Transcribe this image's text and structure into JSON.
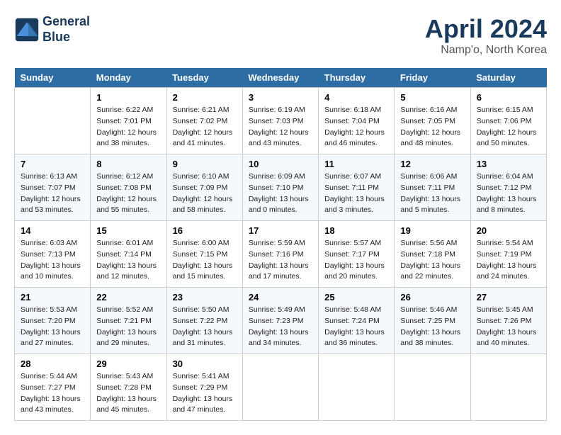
{
  "header": {
    "logo_line1": "General",
    "logo_line2": "Blue",
    "title": "April 2024",
    "subtitle": "Namp'o, North Korea"
  },
  "weekdays": [
    "Sunday",
    "Monday",
    "Tuesday",
    "Wednesday",
    "Thursday",
    "Friday",
    "Saturday"
  ],
  "weeks": [
    [
      null,
      {
        "day": "1",
        "sunrise": "6:22 AM",
        "sunset": "7:01 PM",
        "daylight": "12 hours and 38 minutes."
      },
      {
        "day": "2",
        "sunrise": "6:21 AM",
        "sunset": "7:02 PM",
        "daylight": "12 hours and 41 minutes."
      },
      {
        "day": "3",
        "sunrise": "6:19 AM",
        "sunset": "7:03 PM",
        "daylight": "12 hours and 43 minutes."
      },
      {
        "day": "4",
        "sunrise": "6:18 AM",
        "sunset": "7:04 PM",
        "daylight": "12 hours and 46 minutes."
      },
      {
        "day": "5",
        "sunrise": "6:16 AM",
        "sunset": "7:05 PM",
        "daylight": "12 hours and 48 minutes."
      },
      {
        "day": "6",
        "sunrise": "6:15 AM",
        "sunset": "7:06 PM",
        "daylight": "12 hours and 50 minutes."
      }
    ],
    [
      {
        "day": "7",
        "sunrise": "6:13 AM",
        "sunset": "7:07 PM",
        "daylight": "12 hours and 53 minutes."
      },
      {
        "day": "8",
        "sunrise": "6:12 AM",
        "sunset": "7:08 PM",
        "daylight": "12 hours and 55 minutes."
      },
      {
        "day": "9",
        "sunrise": "6:10 AM",
        "sunset": "7:09 PM",
        "daylight": "12 hours and 58 minutes."
      },
      {
        "day": "10",
        "sunrise": "6:09 AM",
        "sunset": "7:10 PM",
        "daylight": "13 hours and 0 minutes."
      },
      {
        "day": "11",
        "sunrise": "6:07 AM",
        "sunset": "7:11 PM",
        "daylight": "13 hours and 3 minutes."
      },
      {
        "day": "12",
        "sunrise": "6:06 AM",
        "sunset": "7:11 PM",
        "daylight": "13 hours and 5 minutes."
      },
      {
        "day": "13",
        "sunrise": "6:04 AM",
        "sunset": "7:12 PM",
        "daylight": "13 hours and 8 minutes."
      }
    ],
    [
      {
        "day": "14",
        "sunrise": "6:03 AM",
        "sunset": "7:13 PM",
        "daylight": "13 hours and 10 minutes."
      },
      {
        "day": "15",
        "sunrise": "6:01 AM",
        "sunset": "7:14 PM",
        "daylight": "13 hours and 12 minutes."
      },
      {
        "day": "16",
        "sunrise": "6:00 AM",
        "sunset": "7:15 PM",
        "daylight": "13 hours and 15 minutes."
      },
      {
        "day": "17",
        "sunrise": "5:59 AM",
        "sunset": "7:16 PM",
        "daylight": "13 hours and 17 minutes."
      },
      {
        "day": "18",
        "sunrise": "5:57 AM",
        "sunset": "7:17 PM",
        "daylight": "13 hours and 20 minutes."
      },
      {
        "day": "19",
        "sunrise": "5:56 AM",
        "sunset": "7:18 PM",
        "daylight": "13 hours and 22 minutes."
      },
      {
        "day": "20",
        "sunrise": "5:54 AM",
        "sunset": "7:19 PM",
        "daylight": "13 hours and 24 minutes."
      }
    ],
    [
      {
        "day": "21",
        "sunrise": "5:53 AM",
        "sunset": "7:20 PM",
        "daylight": "13 hours and 27 minutes."
      },
      {
        "day": "22",
        "sunrise": "5:52 AM",
        "sunset": "7:21 PM",
        "daylight": "13 hours and 29 minutes."
      },
      {
        "day": "23",
        "sunrise": "5:50 AM",
        "sunset": "7:22 PM",
        "daylight": "13 hours and 31 minutes."
      },
      {
        "day": "24",
        "sunrise": "5:49 AM",
        "sunset": "7:23 PM",
        "daylight": "13 hours and 34 minutes."
      },
      {
        "day": "25",
        "sunrise": "5:48 AM",
        "sunset": "7:24 PM",
        "daylight": "13 hours and 36 minutes."
      },
      {
        "day": "26",
        "sunrise": "5:46 AM",
        "sunset": "7:25 PM",
        "daylight": "13 hours and 38 minutes."
      },
      {
        "day": "27",
        "sunrise": "5:45 AM",
        "sunset": "7:26 PM",
        "daylight": "13 hours and 40 minutes."
      }
    ],
    [
      {
        "day": "28",
        "sunrise": "5:44 AM",
        "sunset": "7:27 PM",
        "daylight": "13 hours and 43 minutes."
      },
      {
        "day": "29",
        "sunrise": "5:43 AM",
        "sunset": "7:28 PM",
        "daylight": "13 hours and 45 minutes."
      },
      {
        "day": "30",
        "sunrise": "5:41 AM",
        "sunset": "7:29 PM",
        "daylight": "13 hours and 47 minutes."
      },
      null,
      null,
      null,
      null
    ]
  ],
  "labels": {
    "sunrise_prefix": "Sunrise: ",
    "sunset_prefix": "Sunset: ",
    "daylight_prefix": "Daylight: "
  }
}
